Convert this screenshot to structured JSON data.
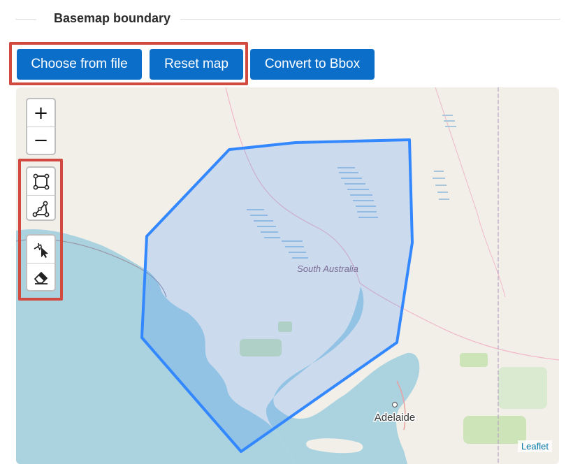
{
  "section": {
    "title": "Basemap boundary"
  },
  "buttons": {
    "choose_file": "Choose from file",
    "reset_map": "Reset map",
    "convert_bbox": "Convert to Bbox"
  },
  "map": {
    "zoom_in": "+",
    "zoom_out": "−",
    "labels": {
      "region": "South Australia",
      "city": "Adelaide"
    },
    "attribution": "Leaflet",
    "icons": {
      "rectangle": "draw-rectangle-icon",
      "polygon": "draw-polygon-icon",
      "edit": "edit-layers-icon",
      "delete": "delete-layers-icon"
    },
    "colors": {
      "land": "#f2efe9",
      "sea": "#aad3df",
      "polygon_stroke": "#3388ff",
      "polygon_fill": "#3388ff",
      "highlight": "#d24a3f",
      "button": "#0b6fc9"
    }
  }
}
